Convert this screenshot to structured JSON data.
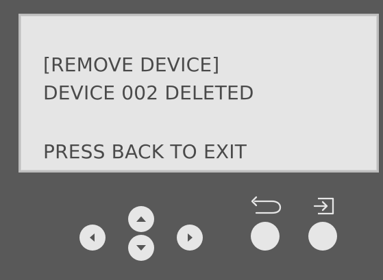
{
  "screen": {
    "title": "[REMOVE DEVICE]",
    "status": "DEVICE 002 DELETED",
    "instruction": "PRESS BACK TO EXIT"
  },
  "controls": {
    "left_icon": "left-arrow-icon",
    "up_icon": "up-arrow-icon",
    "down_icon": "down-arrow-icon",
    "right_icon": "right-arrow-icon",
    "back_icon": "back-arrow-icon",
    "enter_icon": "enter-icon"
  },
  "colors": {
    "panel": "#595959",
    "screen": "#e5e5e5",
    "text": "#4a4a4a",
    "button": "#e6e6e6",
    "icon": "#555555"
  }
}
